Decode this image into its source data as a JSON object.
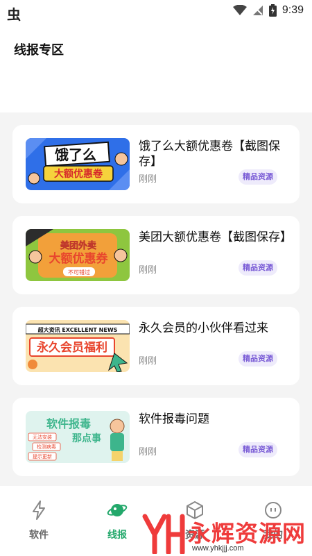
{
  "status_bar": {
    "app_icon": "虫",
    "time": "9:39"
  },
  "header": {
    "title": "线报专区"
  },
  "feed": {
    "items": [
      {
        "title": "饿了么大额优惠卷【截图保存】",
        "time": "刚刚",
        "badge": "精品资源",
        "thumb": {
          "line1": "饿了么",
          "line2": "大额优惠卷",
          "bg": "#2f6fe8",
          "accent": "#f6d33c"
        }
      },
      {
        "title": "美团大额优惠卷【截图保存】",
        "time": "刚刚",
        "badge": "精品资源",
        "thumb": {
          "line1": "美团外卖",
          "line2": "大额优惠券",
          "line3": "不可错过",
          "bg": "#f2a03a",
          "accent": "#8ec63f"
        }
      },
      {
        "title": "永久会员的小伙伴看过来",
        "time": "刚刚",
        "badge": "精品资源",
        "thumb": {
          "line1": "超大资讯 EXCELLENT NEWS",
          "line2": "永久会员福利",
          "bg": "#fbe3b0",
          "accent": "#e8452d"
        }
      },
      {
        "title": "软件报毒问题",
        "time": "刚刚",
        "badge": "精品资源",
        "thumb": {
          "line1": "软件报毒",
          "line2": "那点事",
          "tag1": "无法安装",
          "tag2": "检测病毒",
          "tag3": "提示更新",
          "bg": "#dff3ee",
          "accent": "#3db58c"
        }
      }
    ]
  },
  "tab_bar": {
    "tabs": [
      {
        "label": "软件",
        "icon": "lightning-icon"
      },
      {
        "label": "线报",
        "icon": "planet-icon"
      },
      {
        "label": "资源",
        "icon": "cube-icon"
      },
      {
        "label": "我的",
        "icon": "face-icon"
      }
    ]
  },
  "watermark": {
    "text": "永辉资源网",
    "url": "www.yhkjjj.com"
  }
}
